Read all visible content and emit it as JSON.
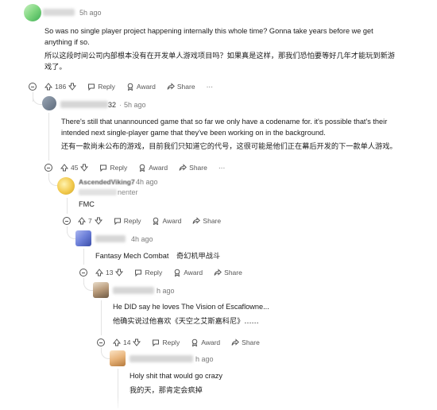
{
  "comments": [
    {
      "username": "",
      "time": "5h ago",
      "lines": [
        "So was no single player project happening internally this whole time? Gonna take years before we get",
        "anything if so."
      ],
      "lines_cn": [
        "所以这段时间公司内部根本没有在开发单人游戏项目吗？如果真是这样，那我们恐怕要等好几年才能玩到新游",
        "戏了。"
      ],
      "votes": "186",
      "reply_label": "Reply",
      "award_label": "Award",
      "share_label": "Share",
      "more": "···"
    },
    {
      "username": "32",
      "time": "5h ago",
      "lines": [
        "There's still that unannounced game that so far we only have a codename for. it's possible that's their",
        "intended next single-player game that they've been working on in the background."
      ],
      "lines_cn": [
        "还有一款尚未公布的游戏，目前我们只知道它的代号，这很可能是他们正在幕后开发的下一款单人游戏。"
      ],
      "votes": "45",
      "reply_label": "Reply",
      "award_label": "Award",
      "share_label": "Share",
      "more": "···"
    },
    {
      "username": "AscendedViking7",
      "time": "4h ago",
      "flair": "nenter",
      "lines": [
        "FMC"
      ],
      "votes": "7",
      "reply_label": "Reply",
      "award_label": "Award",
      "share_label": "Share"
    },
    {
      "username": "",
      "time": "4h ago",
      "lines": [
        "Fantasy Mech Combat"
      ],
      "lines_cn_inline": "奇幻机甲战斗",
      "votes": "13",
      "reply_label": "Reply",
      "award_label": "Award",
      "share_label": "Share"
    },
    {
      "username": "",
      "time": "h ago",
      "lines": [
        "He DID say he loves The Vision of Escaflowne..."
      ],
      "lines_cn": [
        "他确实说过他喜欢《天空之艾斯嘉科尼》……"
      ],
      "votes": "14",
      "reply_label": "Reply",
      "award_label": "Award",
      "share_label": "Share"
    },
    {
      "username": "",
      "time": "h ago",
      "lines": [
        "Holy shit that would go crazy"
      ],
      "lines_cn": [
        "我的天，那肯定会疯掉"
      ]
    }
  ],
  "colors": {
    "avatar1": "#7fd67f",
    "avatar3": "#f2c94c",
    "avatar4": "#6c7fd8",
    "avatar5": "#b89a7a",
    "avatar6": "#e8b47a"
  }
}
